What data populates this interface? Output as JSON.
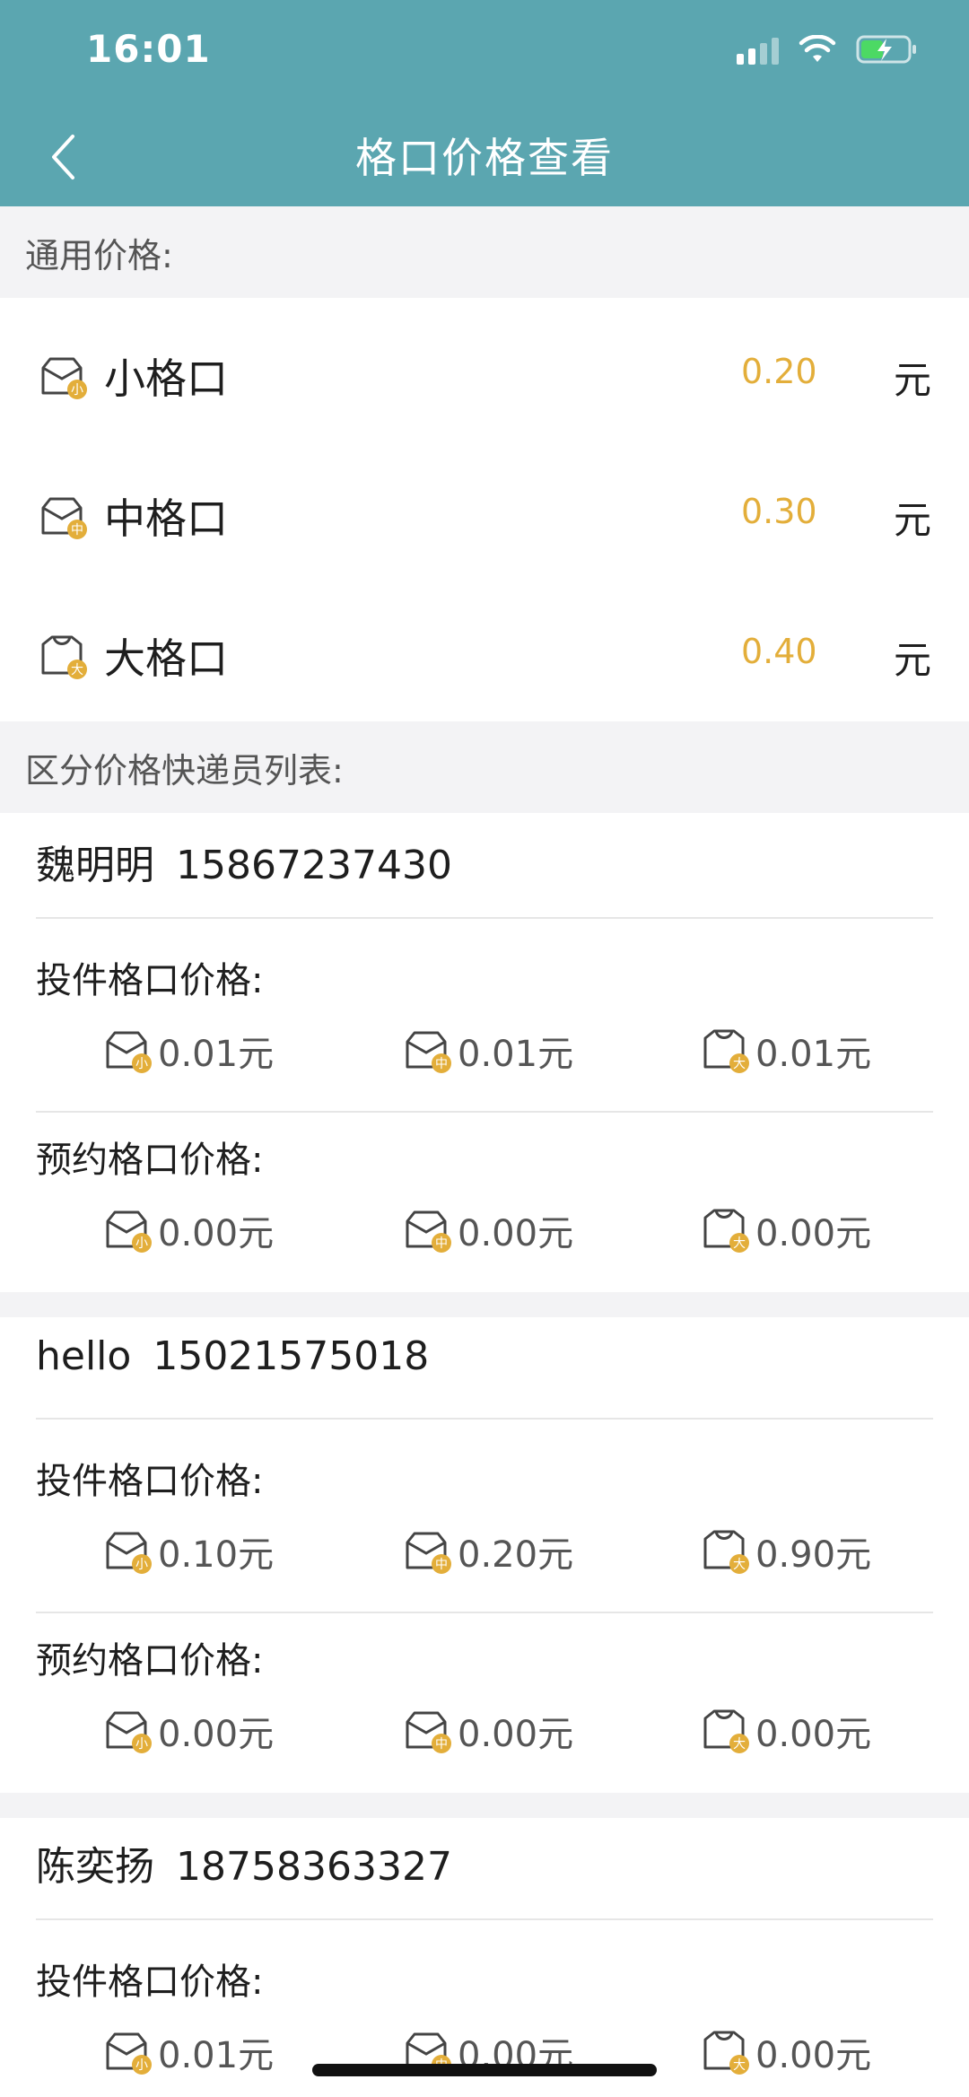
{
  "status_bar": {
    "time": "16:01"
  },
  "header": {
    "title": "格口价格查看"
  },
  "general": {
    "label": "通用价格:",
    "rows": [
      {
        "badge": "小",
        "name": "小格口",
        "price": "0.20",
        "unit": "元"
      },
      {
        "badge": "中",
        "name": "中格口",
        "price": "0.30",
        "unit": "元"
      },
      {
        "badge": "大",
        "name": "大格口",
        "price": "0.40",
        "unit": "元"
      }
    ]
  },
  "couriers_label": "区分价格快递员列表:",
  "labels": {
    "deliver": "投件格口价格:",
    "reserve": "预约格口价格:"
  },
  "badges": [
    "小",
    "中",
    "大"
  ],
  "couriers": [
    {
      "name": "魏明明",
      "phone": "15867237430",
      "deliver": [
        "0.01元",
        "0.01元",
        "0.01元"
      ],
      "reserve": [
        "0.00元",
        "0.00元",
        "0.00元"
      ]
    },
    {
      "name": "hello",
      "phone": "15021575018",
      "deliver": [
        "0.10元",
        "0.20元",
        "0.90元"
      ],
      "reserve": [
        "0.00元",
        "0.00元",
        "0.00元"
      ]
    },
    {
      "name": "陈奕扬",
      "phone": "18758363327",
      "deliver": [
        "0.01元",
        "0.00元",
        "0.00元"
      ]
    }
  ],
  "colors": {
    "header": "#5ba6b0",
    "price": "#e3ae3a",
    "badge": "#e3ae3a"
  }
}
